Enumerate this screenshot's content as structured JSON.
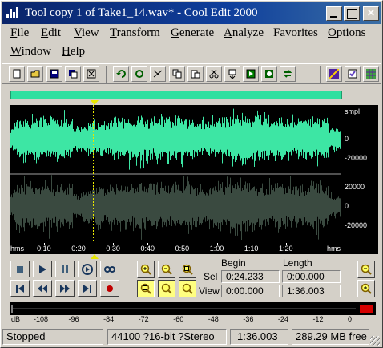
{
  "window": {
    "title": "Tool copy 1 of Take1_14.wav* - Cool Edit 2000",
    "controls": {
      "minimize": "_",
      "maximize": "□",
      "close": "×"
    }
  },
  "menu": {
    "row1": [
      {
        "label": "File",
        "key": "F",
        "rest": "ile"
      },
      {
        "label": "Edit",
        "key": "E",
        "rest": "dit"
      },
      {
        "label": "View",
        "key": "V",
        "rest": "iew"
      },
      {
        "label": "Transform",
        "key": "T",
        "rest": "ransform"
      },
      {
        "label": "Generate",
        "key": "G",
        "rest": "enerate"
      },
      {
        "label": "Analyze",
        "key": "A",
        "rest": "nalyze"
      },
      {
        "label": "Favorites",
        "key": "",
        "rest": "Favorites"
      },
      {
        "label": "Options",
        "key": "O",
        "rest": "ptions"
      }
    ],
    "row2": [
      {
        "label": "Window",
        "key": "W",
        "rest": "indow"
      },
      {
        "label": "Help",
        "key": "H",
        "rest": "elp"
      }
    ]
  },
  "toolbar": {
    "buttons": [
      "new-file-icon",
      "open-file-icon",
      "save-icon",
      "save-as-icon",
      "close-file-icon",
      "undo-icon",
      "repeat-icon",
      "cut-tool-icon",
      "copy-icon",
      "paste-icon",
      "scissors-icon",
      "mix-paste-icon",
      "play-script-icon",
      "cd-icon",
      "loop-icon",
      "spectral-icon",
      "checklist-icon",
      "grid-icon"
    ]
  },
  "waveform": {
    "scale_top": {
      "unit": "smpl",
      "zero": "0",
      "neg": "-20000"
    },
    "scale_bottom": {
      "pos": "20000",
      "zero": "0",
      "neg": "-20000"
    },
    "active_channel_color": "#3de6a4",
    "inactive_channel_color": "#3a4a40",
    "cursor_time": "0:24.233",
    "duration_seconds": 96.003
  },
  "timeline": {
    "ticks": [
      "hms",
      "0:10",
      "0:20",
      "0:30",
      "0:40",
      "0:50",
      "1:00",
      "1:10",
      "1:20",
      "hms"
    ]
  },
  "transport": {
    "row1": [
      "stop-icon",
      "play-icon",
      "pause-icon",
      "play-to-end-icon",
      "loop-icon"
    ],
    "row2": [
      "go-to-start-icon",
      "rewind-icon",
      "fast-forward-icon",
      "go-to-end-icon",
      "record-icon"
    ]
  },
  "zoom": {
    "row1": [
      "zoom-in-icon",
      "zoom-out-icon",
      "zoom-full-icon"
    ],
    "row2": [
      "zoom-selection-icon",
      "zoom-left-icon",
      "zoom-right-icon"
    ],
    "vertical": [
      "zoom-in-vertical-icon",
      "zoom-out-vertical-icon"
    ]
  },
  "selection": {
    "begin_header": "Begin",
    "length_header": "Length",
    "sel_label": "Sel",
    "view_label": "View",
    "sel_begin": "0:24.233",
    "sel_length": "0:00.000",
    "view_begin": "0:00.000",
    "view_length": "1:36.003"
  },
  "meter": {
    "unit": "dB",
    "ticks": [
      "dB",
      "-108",
      "-96",
      "-84",
      "-72",
      "-60",
      "-48",
      "-36",
      "-24",
      "-12",
      "0"
    ],
    "clip_color": "#d40000"
  },
  "status": {
    "state": "Stopped",
    "format": "44100 ?16-bit ?Stereo",
    "length": "1:36.003",
    "free": "289.29 MB free"
  }
}
